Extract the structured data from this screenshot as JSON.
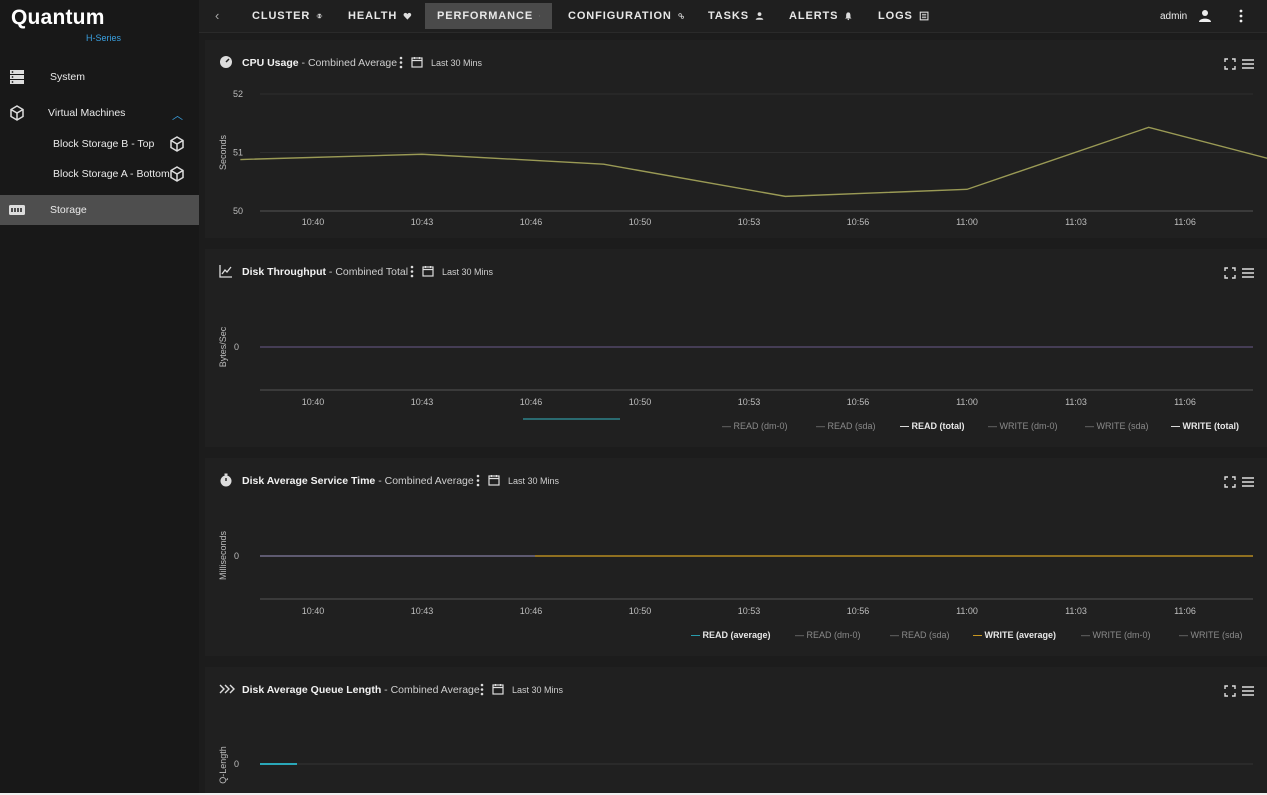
{
  "brand": {
    "name": "Quantum",
    "series": "H-Series"
  },
  "sidebar": {
    "items": [
      {
        "label": "System",
        "icon": "server-icon"
      },
      {
        "label": "Virtual Machines",
        "icon": "cube-icon"
      },
      {
        "label": "Block Storage B - Top",
        "icon": "cube-icon"
      },
      {
        "label": "Block Storage A - Bottom",
        "icon": "cube-icon"
      },
      {
        "label": "Storage",
        "icon": "storage-icon"
      }
    ]
  },
  "topnav": {
    "back": "‹",
    "tabs": [
      {
        "label": "CLUSTER",
        "icon": "cluster-icon"
      },
      {
        "label": "HEALTH",
        "icon": "heart-icon"
      },
      {
        "label": "PERFORMANCE",
        "icon": "gauge-icon"
      },
      {
        "label": "CONFIGURATION",
        "icon": "gears-icon"
      },
      {
        "label": "TASKS",
        "icon": "person-icon"
      },
      {
        "label": "ALERTS",
        "icon": "bell-icon"
      },
      {
        "label": "LOGS",
        "icon": "log-icon"
      }
    ],
    "active_tab": "PERFORMANCE",
    "user": "admin"
  },
  "panels": [
    {
      "title": "CPU Usage",
      "subtitle": " - Combined Average",
      "range": "Last 30 Mins"
    },
    {
      "title": "Disk Throughput",
      "subtitle": " - Combined Total",
      "range": "Last 30 Mins"
    },
    {
      "title": "Disk Average Service Time",
      "subtitle": " - Combined Average",
      "range": "Last 30 Mins"
    },
    {
      "title": "Disk Average Queue Length",
      "subtitle": " - Combined Average",
      "range": "Last 30 Mins"
    }
  ],
  "colors": {
    "accent": "#3aa0e0",
    "cpu_line": "#9a9a55",
    "read": "#2aa7b8",
    "write": "#d4a020",
    "active_bg": "#4a4a4a"
  },
  "chart_data": [
    {
      "type": "line",
      "title": "CPU Usage",
      "ylabel": "Seconds",
      "ylim": [
        50,
        52
      ],
      "y_ticks": [
        "52",
        "51",
        "50"
      ],
      "x_ticks": [
        "10:40",
        "10:43",
        "10:46",
        "10:50",
        "10:53",
        "10:56",
        "11:00",
        "11:03",
        "11:06"
      ],
      "series": [
        {
          "x": [
            "10:38",
            "10:43",
            "10:48",
            "10:53",
            "10:58",
            "11:03",
            "11:08"
          ],
          "values": [
            50.88,
            50.97,
            50.8,
            50.25,
            50.37,
            51.43,
            50.62
          ]
        }
      ]
    },
    {
      "type": "line",
      "title": "Disk Throughput",
      "ylabel": "Bytes/Sec",
      "y_ticks": [
        "0"
      ],
      "x_ticks": [
        "10:40",
        "10:43",
        "10:46",
        "10:50",
        "10:53",
        "10:56",
        "11:00",
        "11:03",
        "11:06"
      ],
      "legend": [
        {
          "label": "READ (dm-0)",
          "on": false
        },
        {
          "label": "READ (sda)",
          "on": false
        },
        {
          "label": "READ (total)",
          "on": true
        },
        {
          "label": "WRITE (dm-0)",
          "on": false
        },
        {
          "label": "WRITE (sda)",
          "on": false
        },
        {
          "label": "WRITE (total)",
          "on": true
        }
      ],
      "series": [
        {
          "name": "READ (total)",
          "values": [
            0,
            0,
            0,
            0,
            0,
            0,
            0,
            0,
            0
          ]
        },
        {
          "name": "WRITE (total)",
          "values": [
            0,
            0,
            0,
            0,
            0,
            0,
            0,
            0,
            0
          ]
        }
      ]
    },
    {
      "type": "line",
      "title": "Disk Average Service Time",
      "ylabel": "Milliseconds",
      "y_ticks": [
        "0"
      ],
      "x_ticks": [
        "10:40",
        "10:43",
        "10:46",
        "10:50",
        "10:53",
        "10:56",
        "11:00",
        "11:03",
        "11:06"
      ],
      "legend": [
        {
          "label": "READ (average)",
          "on": true,
          "color": "#2aa7b8"
        },
        {
          "label": "READ (dm-0)",
          "on": false
        },
        {
          "label": "READ (sda)",
          "on": false
        },
        {
          "label": "WRITE (average)",
          "on": true,
          "color": "#d4a020"
        },
        {
          "label": "WRITE (dm-0)",
          "on": false
        },
        {
          "label": "WRITE (sda)",
          "on": false
        }
      ],
      "series": [
        {
          "name": "READ (average)",
          "values": [
            0,
            0,
            0,
            0,
            0,
            0,
            0,
            0,
            0
          ]
        },
        {
          "name": "WRITE (average)",
          "values": [
            0,
            0,
            0,
            0,
            0,
            0,
            0,
            0,
            0
          ]
        }
      ]
    },
    {
      "type": "line",
      "title": "Disk Average Queue Length",
      "ylabel": "Q-Length",
      "y_ticks": [
        "0"
      ],
      "series": [
        {
          "values": [
            0,
            0
          ]
        }
      ]
    }
  ]
}
